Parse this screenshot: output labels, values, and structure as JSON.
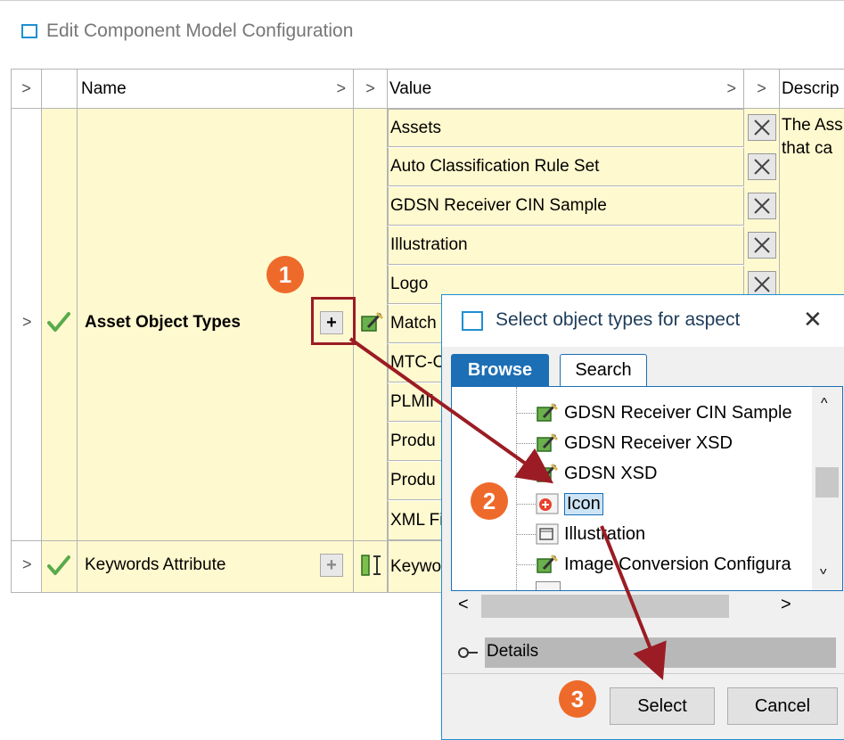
{
  "window": {
    "title": "Edit Component Model Configuration"
  },
  "grid": {
    "headers": {
      "name": "Name",
      "value": "Value",
      "description": "Descrip"
    },
    "rows": [
      {
        "name": "Asset Object Types",
        "values": [
          "Assets",
          "Auto Classification Rule Set",
          "GDSN Receiver CIN Sample",
          "Illustration",
          "Logo",
          "Match",
          "MTC-C",
          "PLMIi",
          "Produ",
          "Produ",
          "XML Fi"
        ],
        "description": "The Ass\nthat ca"
      },
      {
        "name": "Keywords Attribute",
        "values": [
          "Keywo"
        ]
      }
    ]
  },
  "dialog": {
    "title": "Select object types for aspect",
    "tabs": [
      "Browse",
      "Search"
    ],
    "tree_items": [
      {
        "label": "GDSN Receiver CIN Sample",
        "icon": "object-type-icon"
      },
      {
        "label": "GDSN Receiver XSD",
        "icon": "object-type-icon"
      },
      {
        "label": "GDSN XSD",
        "icon": "object-type-icon"
      },
      {
        "label": "Icon",
        "icon": "icon-type-icon",
        "selected": true
      },
      {
        "label": "Illustration",
        "icon": "asset-type-icon"
      },
      {
        "label": "Image Conversion Configura",
        "icon": "object-type-icon"
      }
    ],
    "details_label": "Details",
    "buttons": {
      "select": "Select",
      "cancel": "Cancel"
    }
  },
  "badges": [
    "1",
    "2",
    "3"
  ],
  "colors": {
    "accent": "#1f8fd1",
    "badge": "#ee6a2b",
    "arrow": "#9b1c24",
    "row_bg": "#fff9cf",
    "tab_active": "#1c6fb5"
  }
}
